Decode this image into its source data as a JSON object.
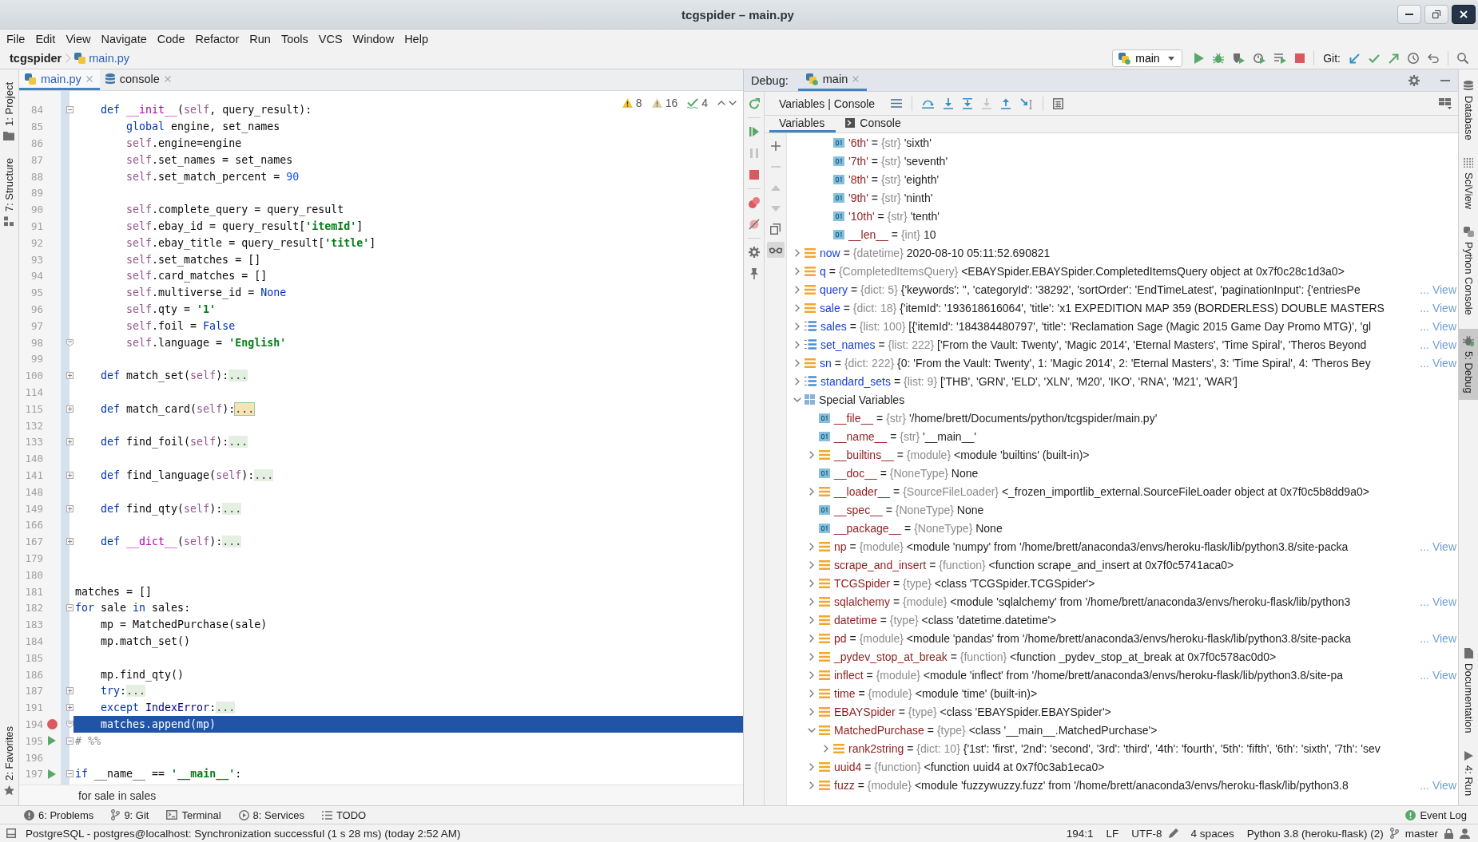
{
  "window": {
    "title": "tcgspider – main.py"
  },
  "menu": [
    "File",
    "Edit",
    "View",
    "Navigate",
    "Code",
    "Refactor",
    "Run",
    "Tools",
    "VCS",
    "Window",
    "Help"
  ],
  "navigation": {
    "breadcrumbs": [
      {
        "label": "tcgspider",
        "kind": "project",
        "modified": false
      },
      {
        "label": "main.py",
        "kind": "file",
        "modified": true
      }
    ],
    "run_config": "main",
    "git_label": "Git:"
  },
  "left_tool_windows": {
    "top": [
      {
        "label": "1: Project",
        "kind": "project",
        "selected": false
      },
      {
        "label": "7: Structure",
        "kind": "structure",
        "selected": false
      }
    ],
    "bottom": [
      {
        "label": "2: Favorites",
        "kind": "favorites",
        "selected": false
      }
    ]
  },
  "editor": {
    "tabs": [
      {
        "label": "main.py",
        "kind": "python",
        "modified": true,
        "selected": true
      },
      {
        "label": "console",
        "kind": "console",
        "modified": false,
        "selected": false
      }
    ],
    "inspections": [
      {
        "kind": "warning",
        "count": "8"
      },
      {
        "kind": "weak_warning",
        "count": "16"
      },
      {
        "kind": "typo",
        "count": "4"
      }
    ],
    "lines": [
      {
        "kind": "scrolled_out",
        "children": [
          {
            "number": "84",
            "fold": {
              "kind": "start",
              "collapsed": false
            },
            "breakpoint": false,
            "run_marker": false,
            "current": false,
            "tokens": [
              {
                "kind": "keyword",
                "text": "def "
              },
              {
                "kind": "magic",
                "text": "__init__"
              },
              {
                "kind": "plain",
                "text": "("
              },
              {
                "kind": "self",
                "text": "self"
              },
              {
                "kind": "plain",
                "text": ", query_result):"
              }
            ],
            "children": [
              {
                "number": "85",
                "breakpoint": false,
                "run_marker": false,
                "current": false,
                "tokens": [
                  {
                    "kind": "keyword",
                    "text": "global"
                  },
                  {
                    "kind": "plain",
                    "text": " engine, set_names"
                  }
                ]
              },
              {
                "number": "86",
                "breakpoint": false,
                "run_marker": false,
                "current": false,
                "tokens": [
                  {
                    "kind": "self",
                    "text": "self"
                  },
                  {
                    "kind": "plain",
                    "text": ".engine=engine"
                  }
                ]
              },
              {
                "number": "87",
                "breakpoint": false,
                "run_marker": false,
                "current": false,
                "tokens": [
                  {
                    "kind": "self",
                    "text": "self"
                  },
                  {
                    "kind": "plain",
                    "text": ".set_names = set_names"
                  }
                ]
              },
              {
                "number": "88",
                "breakpoint": false,
                "run_marker": false,
                "current": false,
                "tokens": [
                  {
                    "kind": "self",
                    "text": "self"
                  },
                  {
                    "kind": "plain",
                    "text": ".set_match_percent = "
                  },
                  {
                    "kind": "number",
                    "text": "90"
                  }
                ]
              },
              {
                "number": "89",
                "breakpoint": false,
                "run_marker": false,
                "current": false
              },
              {
                "number": "90",
                "breakpoint": false,
                "run_marker": false,
                "current": false,
                "tokens": [
                  {
                    "kind": "self",
                    "text": "self"
                  },
                  {
                    "kind": "plain",
                    "text": ".complete_query = query_result"
                  }
                ]
              },
              {
                "number": "91",
                "breakpoint": false,
                "run_marker": false,
                "current": false,
                "tokens": [
                  {
                    "kind": "self",
                    "text": "self"
                  },
                  {
                    "kind": "plain",
                    "text": ".ebay_id = query_result["
                  },
                  {
                    "kind": "string",
                    "text": "'itemId'"
                  },
                  {
                    "kind": "plain",
                    "text": "]"
                  }
                ]
              },
              {
                "number": "92",
                "breakpoint": false,
                "run_marker": false,
                "current": false,
                "tokens": [
                  {
                    "kind": "self",
                    "text": "self"
                  },
                  {
                    "kind": "plain",
                    "text": ".ebay_title = query_result["
                  },
                  {
                    "kind": "string",
                    "text": "'title'"
                  },
                  {
                    "kind": "plain",
                    "text": "]"
                  }
                ]
              },
              {
                "number": "93",
                "breakpoint": false,
                "run_marker": false,
                "current": false,
                "tokens": [
                  {
                    "kind": "self",
                    "text": "self"
                  },
                  {
                    "kind": "plain",
                    "text": ".set_matches = []"
                  }
                ]
              },
              {
                "number": "94",
                "breakpoint": false,
                "run_marker": false,
                "current": false,
                "tokens": [
                  {
                    "kind": "self",
                    "text": "self"
                  },
                  {
                    "kind": "plain",
                    "text": ".card_matches = []"
                  }
                ]
              },
              {
                "number": "95",
                "breakpoint": false,
                "run_marker": false,
                "current": false,
                "tokens": [
                  {
                    "kind": "self",
                    "text": "self"
                  },
                  {
                    "kind": "plain",
                    "text": ".multiverse_id = "
                  },
                  {
                    "kind": "keyword",
                    "text": "None"
                  }
                ]
              },
              {
                "number": "96",
                "breakpoint": false,
                "run_marker": false,
                "current": false,
                "tokens": [
                  {
                    "kind": "self",
                    "text": "self"
                  },
                  {
                    "kind": "plain",
                    "text": ".qty = "
                  },
                  {
                    "kind": "string",
                    "text": "'1'"
                  }
                ]
              },
              {
                "number": "97",
                "breakpoint": false,
                "run_marker": false,
                "current": false,
                "tokens": [
                  {
                    "kind": "self",
                    "text": "self"
                  },
                  {
                    "kind": "plain",
                    "text": ".foil = "
                  },
                  {
                    "kind": "keyword",
                    "text": "False"
                  }
                ]
              },
              {
                "number": "98",
                "fold": {
                  "kind": "end"
                },
                "breakpoint": false,
                "run_marker": false,
                "current": false,
                "tokens": [
                  {
                    "kind": "self",
                    "text": "self"
                  },
                  {
                    "kind": "plain",
                    "text": ".language = "
                  },
                  {
                    "kind": "string",
                    "text": "'English'"
                  }
                ]
              }
            ]
          },
          {
            "number": "99",
            "breakpoint": false,
            "run_marker": false,
            "current": false
          },
          {
            "number": "100",
            "fold": {
              "kind": "start",
              "collapsed": true
            },
            "breakpoint": false,
            "run_marker": false,
            "current": false,
            "tokens": [
              {
                "kind": "keyword",
                "text": "def "
              },
              {
                "kind": "plain",
                "text": "match_set("
              },
              {
                "kind": "self",
                "text": "self"
              },
              {
                "kind": "plain",
                "text": "):"
              },
              {
                "kind": "fold",
                "text": "..."
              }
            ]
          },
          {
            "number": "114",
            "breakpoint": false,
            "run_marker": false,
            "current": false
          },
          {
            "number": "115",
            "fold": {
              "kind": "start",
              "collapsed": true
            },
            "breakpoint": false,
            "run_marker": false,
            "current": false,
            "tokens": [
              {
                "kind": "keyword",
                "text": "def "
              },
              {
                "kind": "plain",
                "text": "match_card("
              },
              {
                "kind": "self",
                "text": "self"
              },
              {
                "kind": "plain",
                "text": "):"
              },
              {
                "kind": "fold_match",
                "text": "..."
              }
            ]
          },
          {
            "number": "132",
            "breakpoint": false,
            "run_marker": false,
            "current": false
          },
          {
            "number": "133",
            "fold": {
              "kind": "start",
              "collapsed": true
            },
            "breakpoint": false,
            "run_marker": false,
            "current": false,
            "tokens": [
              {
                "kind": "keyword",
                "text": "def "
              },
              {
                "kind": "plain",
                "text": "find_foil("
              },
              {
                "kind": "self",
                "text": "self"
              },
              {
                "kind": "plain",
                "text": "):"
              },
              {
                "kind": "fold",
                "text": "..."
              }
            ]
          },
          {
            "number": "140",
            "breakpoint": false,
            "run_marker": false,
            "current": false
          },
          {
            "number": "141",
            "fold": {
              "kind": "start",
              "collapsed": true
            },
            "breakpoint": false,
            "run_marker": false,
            "current": false,
            "tokens": [
              {
                "kind": "keyword",
                "text": "def "
              },
              {
                "kind": "plain",
                "text": "find_language("
              },
              {
                "kind": "self",
                "text": "self"
              },
              {
                "kind": "plain",
                "text": "):"
              },
              {
                "kind": "fold",
                "text": "..."
              }
            ]
          },
          {
            "number": "148",
            "breakpoint": false,
            "run_marker": false,
            "current": false
          },
          {
            "number": "149",
            "fold": {
              "kind": "start",
              "collapsed": true
            },
            "breakpoint": false,
            "run_marker": false,
            "current": false,
            "tokens": [
              {
                "kind": "keyword",
                "text": "def "
              },
              {
                "kind": "plain",
                "text": "find_qty("
              },
              {
                "kind": "self",
                "text": "self"
              },
              {
                "kind": "plain",
                "text": "):"
              },
              {
                "kind": "fold",
                "text": "..."
              }
            ]
          },
          {
            "number": "166",
            "breakpoint": false,
            "run_marker": false,
            "current": false
          },
          {
            "number": "167",
            "fold": {
              "kind": "start",
              "collapsed": true
            },
            "breakpoint": false,
            "run_marker": false,
            "current": false,
            "tokens": [
              {
                "kind": "keyword",
                "text": "def "
              },
              {
                "kind": "magic",
                "text": "__dict__"
              },
              {
                "kind": "plain",
                "text": "("
              },
              {
                "kind": "self",
                "text": "self"
              },
              {
                "kind": "plain",
                "text": "):"
              },
              {
                "kind": "fold",
                "text": "..."
              }
            ]
          }
        ]
      },
      {
        "number": "179",
        "breakpoint": false,
        "run_marker": false,
        "current": false
      },
      {
        "number": "180",
        "breakpoint": false,
        "run_marker": false,
        "current": false
      },
      {
        "number": "181",
        "breakpoint": false,
        "run_marker": false,
        "current": false,
        "tokens": [
          {
            "kind": "plain",
            "text": "matches = []"
          }
        ]
      },
      {
        "number": "182",
        "fold": {
          "kind": "start",
          "collapsed": false
        },
        "breakpoint": false,
        "run_marker": false,
        "current": false,
        "tokens": [
          {
            "kind": "keyword",
            "text": "for"
          },
          {
            "kind": "plain",
            "text": " sale "
          },
          {
            "kind": "keyword",
            "text": "in"
          },
          {
            "kind": "plain",
            "text": " sales:"
          }
        ],
        "children": [
          {
            "number": "183",
            "breakpoint": false,
            "run_marker": false,
            "current": false,
            "tokens": [
              {
                "kind": "plain",
                "text": "mp = MatchedPurchase(sale)"
              }
            ]
          },
          {
            "number": "184",
            "breakpoint": false,
            "run_marker": false,
            "current": false,
            "tokens": [
              {
                "kind": "plain",
                "text": "mp.match_set()"
              }
            ]
          },
          {
            "number": "185",
            "breakpoint": false,
            "run_marker": false,
            "current": false
          },
          {
            "number": "186",
            "breakpoint": false,
            "run_marker": false,
            "current": false,
            "tokens": [
              {
                "kind": "plain",
                "text": "mp.find_qty()"
              }
            ]
          },
          {
            "number": "187",
            "fold": {
              "kind": "start",
              "collapsed": true
            },
            "breakpoint": false,
            "run_marker": false,
            "current": false,
            "tokens": [
              {
                "kind": "keyword",
                "text": "try"
              },
              {
                "kind": "plain",
                "text": ":"
              },
              {
                "kind": "fold",
                "text": "..."
              }
            ]
          },
          {
            "number": "191",
            "fold": {
              "kind": "start",
              "collapsed": true
            },
            "breakpoint": false,
            "run_marker": false,
            "current": false,
            "tokens": [
              {
                "kind": "keyword",
                "text": "except "
              },
              {
                "kind": "builtin",
                "text": "IndexError"
              },
              {
                "kind": "plain",
                "text": ":"
              },
              {
                "kind": "fold",
                "text": "..."
              }
            ]
          },
          {
            "number": "194",
            "fold": {
              "kind": "end"
            },
            "breakpoint": true,
            "run_marker": false,
            "current": true,
            "tokens": [
              {
                "kind": "plain",
                "text": "matches.append(mp)"
              }
            ]
          }
        ]
      },
      {
        "number": "195",
        "fold": {
          "kind": "start",
          "collapsed": false
        },
        "breakpoint": false,
        "run_marker": true,
        "current": false,
        "tokens": [
          {
            "kind": "comment",
            "text": "# %%"
          }
        ]
      },
      {
        "number": "196",
        "breakpoint": false,
        "run_marker": false,
        "current": false
      },
      {
        "number": "197",
        "fold": {
          "kind": "start",
          "collapsed": false
        },
        "breakpoint": false,
        "run_marker": true,
        "current": false,
        "tokens": [
          {
            "kind": "keyword",
            "text": "if "
          },
          {
            "kind": "plain",
            "text": "__name__ == "
          },
          {
            "kind": "string",
            "text": "'__main__'"
          },
          {
            "kind": "plain",
            "text": ":"
          }
        ]
      }
    ],
    "breadcrumb": "for sale in sales"
  },
  "debug": {
    "title": "Debug:",
    "sessions": [
      {
        "label": "main",
        "selected": true
      }
    ],
    "view_label": "Variables | Console",
    "subtabs": [
      {
        "label": "Variables",
        "kind": "variables",
        "selected": true
      },
      {
        "label": "Console",
        "kind": "console",
        "selected": false
      }
    ],
    "variables": [
      {
        "kind": "scrolled_out",
        "children": [
          {
            "kind": "scrolled_out",
            "children": [
              {
                "kind": "leaf",
                "name": "'6th'",
                "operator": "=",
                "type": "{str}",
                "value": "'sixth'",
                "changed": false
              },
              {
                "kind": "leaf",
                "name": "'7th'",
                "operator": "=",
                "type": "{str}",
                "value": "'seventh'",
                "changed": false
              },
              {
                "kind": "leaf",
                "name": "'8th'",
                "operator": "=",
                "type": "{str}",
                "value": "'eighth'",
                "changed": false
              },
              {
                "kind": "leaf",
                "name": "'9th'",
                "operator": "=",
                "type": "{str}",
                "value": "'ninth'",
                "changed": false
              },
              {
                "kind": "leaf",
                "name": "'10th'",
                "operator": "=",
                "type": "{str}",
                "value": "'tenth'",
                "changed": false
              },
              {
                "kind": "leaf",
                "name": "__len__",
                "operator": "=",
                "type": "{int}",
                "value": "10",
                "changed": false
              }
            ]
          }
        ]
      },
      {
        "kind": "object",
        "name": "now",
        "operator": "=",
        "type": "{datetime}",
        "value": "2020-08-10 05:11:52.690821",
        "changed": true,
        "expanded": false
      },
      {
        "kind": "object",
        "name": "q",
        "operator": "=",
        "type": "{CompletedItemsQuery}",
        "value": "<EBAYSpider.EBAYSpider.CompletedItemsQuery object at 0x7f0c28c1d3a0>",
        "changed": true,
        "expanded": false
      },
      {
        "kind": "object",
        "name": "query",
        "operator": "=",
        "type": "{dict: 5}",
        "value": "{'keywords': '', 'categoryId': '38292', 'sortOrder': 'EndTimeLatest', 'paginationInput': {'entriesPe",
        "link": "... View",
        "changed": true,
        "expanded": false
      },
      {
        "kind": "object",
        "name": "sale",
        "operator": "=",
        "type": "{dict: 18}",
        "value": "{'itemId': '193618616064', 'title': 'x1 EXPEDITION MAP 359 (BORDERLESS) DOUBLE MASTERS",
        "link": "... View",
        "changed": true,
        "expanded": false
      },
      {
        "kind": "list",
        "name": "sales",
        "operator": "=",
        "type": "{list: 100}",
        "value": "[{'itemId': '184384480797', 'title': 'Reclamation Sage (Magic 2015 Game Day Promo MTG)', 'gl",
        "link": "... View",
        "changed": true,
        "expanded": false
      },
      {
        "kind": "list",
        "name": "set_names",
        "operator": "=",
        "type": "{list: 222}",
        "value": "['From the Vault: Twenty', 'Magic 2014', 'Eternal Masters', 'Time Spiral', 'Theros Beyond",
        "link": "... View",
        "changed": true,
        "expanded": false
      },
      {
        "kind": "object",
        "name": "sn",
        "operator": "=",
        "type": "{dict: 222}",
        "value": "{0: 'From the Vault: Twenty', 1: 'Magic 2014', 2: 'Eternal Masters', 3: 'Time Spiral', 4: 'Theros Bey",
        "link": "... View",
        "changed": true,
        "expanded": false
      },
      {
        "kind": "list",
        "name": "standard_sets",
        "operator": "=",
        "type": "{list: 9}",
        "value": "['THB', 'GRN', 'ELD', 'XLN', 'M20', 'IKO', 'RNA', 'M21', 'WAR']",
        "changed": true,
        "expanded": false
      },
      {
        "kind": "group",
        "name": "Special Variables",
        "expanded": true,
        "children": [
          {
            "kind": "leaf",
            "name": "__file__",
            "operator": "=",
            "type": "{str}",
            "value": "'/home/brett/Documents/python/tcgspider/main.py'",
            "changed": false
          },
          {
            "kind": "leaf",
            "name": "__name__",
            "operator": "=",
            "type": "{str}",
            "value": "'__main__'",
            "changed": false
          },
          {
            "kind": "object",
            "name": "__builtins__",
            "operator": "=",
            "type": "{module}",
            "value": "<module 'builtins' (built-in)>",
            "changed": false,
            "expanded": false
          },
          {
            "kind": "leaf",
            "name": "__doc__",
            "operator": "=",
            "type": "{NoneType}",
            "value": "None",
            "changed": false
          },
          {
            "kind": "object",
            "name": "__loader__",
            "operator": "=",
            "type": "{SourceFileLoader}",
            "value": "<_frozen_importlib_external.SourceFileLoader object at 0x7f0c5b8dd9a0>",
            "changed": false,
            "expanded": false
          },
          {
            "kind": "leaf",
            "name": "__spec__",
            "operator": "=",
            "type": "{NoneType}",
            "value": "None",
            "changed": false
          },
          {
            "kind": "leaf",
            "name": "__package__",
            "operator": "=",
            "type": "{NoneType}",
            "value": "None",
            "changed": false
          },
          {
            "kind": "object",
            "name": "np",
            "operator": "=",
            "type": "{module}",
            "value": "<module 'numpy' from '/home/brett/anaconda3/envs/heroku-flask/lib/python3.8/site-packa",
            "link": "... View",
            "changed": false,
            "expanded": false
          },
          {
            "kind": "object",
            "name": "scrape_and_insert",
            "operator": "=",
            "type": "{function}",
            "value": "<function scrape_and_insert at 0x7f0c5741aca0>",
            "changed": false,
            "expanded": false
          },
          {
            "kind": "object",
            "name": "TCGSpider",
            "operator": "=",
            "type": "{type}",
            "value": "<class 'TCGSpider.TCGSpider'>",
            "changed": false,
            "expanded": false
          },
          {
            "kind": "object",
            "name": "sqlalchemy",
            "operator": "=",
            "type": "{module}",
            "value": "<module 'sqlalchemy' from '/home/brett/anaconda3/envs/heroku-flask/lib/python3",
            "link": "... View",
            "changed": false,
            "expanded": false
          },
          {
            "kind": "object",
            "name": "datetime",
            "operator": "=",
            "type": "{type}",
            "value": "<class 'datetime.datetime'>",
            "changed": false,
            "expanded": false
          },
          {
            "kind": "object",
            "name": "pd",
            "operator": "=",
            "type": "{module}",
            "value": "<module 'pandas' from '/home/brett/anaconda3/envs/heroku-flask/lib/python3.8/site-packa",
            "link": "... View",
            "changed": false,
            "expanded": false
          },
          {
            "kind": "object",
            "name": "_pydev_stop_at_break",
            "operator": "=",
            "type": "{function}",
            "value": "<function _pydev_stop_at_break at 0x7f0c578ac0d0>",
            "changed": false,
            "expanded": false
          },
          {
            "kind": "object",
            "name": "inflect",
            "operator": "=",
            "type": "{module}",
            "value": "<module 'inflect' from '/home/brett/anaconda3/envs/heroku-flask/lib/python3.8/site-pa",
            "link": "... View",
            "changed": false,
            "expanded": false
          },
          {
            "kind": "object",
            "name": "time",
            "operator": "=",
            "type": "{module}",
            "value": "<module 'time' (built-in)>",
            "changed": false,
            "expanded": false
          },
          {
            "kind": "object",
            "name": "EBAYSpider",
            "operator": "=",
            "type": "{type}",
            "value": "<class 'EBAYSpider.EBAYSpider'>",
            "changed": false,
            "expanded": false
          },
          {
            "kind": "object",
            "name": "MatchedPurchase",
            "operator": "=",
            "type": "{type}",
            "value": "<class '__main__.MatchedPurchase'>",
            "changed": false,
            "expanded": true,
            "children": [
              {
                "kind": "object",
                "name": "rank2string",
                "operator": "=",
                "type": "{dict: 10}",
                "value": "{'1st': 'first', '2nd': 'second', '3rd': 'third', '4th': 'fourth', '5th': 'fifth', '6th': 'sixth', '7th': 'sev",
                "changed": false,
                "expanded": false
              }
            ]
          },
          {
            "kind": "object",
            "name": "uuid4",
            "operator": "=",
            "type": "{function}",
            "value": "<function uuid4 at 0x7f0c3ab1eca0>",
            "changed": false,
            "expanded": false
          },
          {
            "kind": "object",
            "name": "fuzz",
            "operator": "=",
            "type": "{module}",
            "value": "<module 'fuzzywuzzy.fuzz' from '/home/brett/anaconda3/envs/heroku-flask/lib/python3.8",
            "link": "... View",
            "changed": false,
            "expanded": false
          }
        ]
      }
    ]
  },
  "right_tool_windows": {
    "top": [
      {
        "label": "Database",
        "kind": "database",
        "selected": false
      },
      {
        "label": "SciView",
        "kind": "sciview",
        "selected": false
      },
      {
        "label": "Python Console",
        "kind": "python_console",
        "selected": false
      },
      {
        "label": "5: Debug",
        "kind": "debug",
        "selected": true
      }
    ],
    "bottom": [
      {
        "label": "Documentation",
        "kind": "documentation",
        "selected": false
      },
      {
        "label": "4: Run",
        "kind": "run",
        "selected": false
      }
    ]
  },
  "bottom_tool_windows": [
    {
      "label": "6: Problems",
      "kind": "problems"
    },
    {
      "label": "9: Git",
      "kind": "git"
    },
    {
      "label": "Terminal",
      "kind": "terminal"
    },
    {
      "label": "8: Services",
      "kind": "services"
    },
    {
      "label": "TODO",
      "kind": "todo"
    }
  ],
  "event_log": "Event Log",
  "status_bar": {
    "message": "PostgreSQL - postgres@localhost: Synchronization successful (1 s 28 ms) (today 2:52 AM)",
    "items": [
      {
        "kind": "position",
        "label": "194:1"
      },
      {
        "kind": "line_separator",
        "label": "LF"
      },
      {
        "kind": "encoding",
        "label": "UTF-8"
      },
      {
        "kind": "indent",
        "label": "4 spaces"
      },
      {
        "kind": "interpreter",
        "label": "Python 3.8 (heroku-flask) (2)"
      },
      {
        "kind": "branch",
        "label": "master"
      }
    ]
  }
}
